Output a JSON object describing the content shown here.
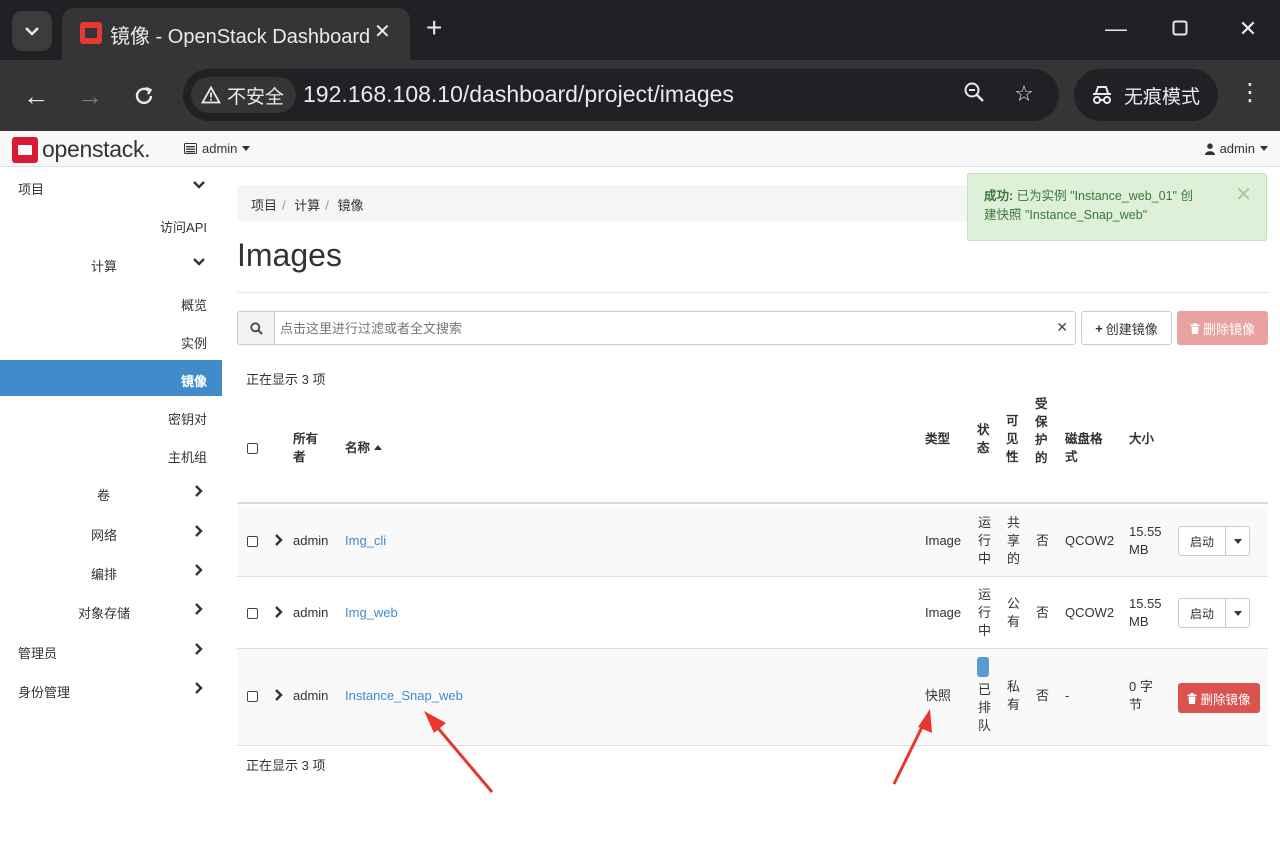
{
  "browser": {
    "tab_title": "镜像 - OpenStack Dashboard",
    "insecure_label": "不安全",
    "url": "192.168.108.10/dashboard/project/images",
    "incognito_label": "无痕模式"
  },
  "navbar": {
    "project": "admin",
    "user": "admin"
  },
  "sidebar": {
    "project": "项目",
    "access_api": "访问API",
    "compute": "计算",
    "overview": "概览",
    "instances": "实例",
    "images": "镜像",
    "keypairs": "密钥对",
    "server_groups": "主机组",
    "volumes": "卷",
    "network": "网络",
    "orchestration": "编排",
    "object_store": "对象存储",
    "admin": "管理员",
    "identity": "身份管理"
  },
  "breadcrumb": [
    "项目",
    "计算",
    "镜像"
  ],
  "page_title": "Images",
  "alert": {
    "strong": "成功:",
    "text_1": " 已为实例 \"Instance_web_01\" 创",
    "text_2": "建快照 \"Instance_Snap_web\""
  },
  "search": {
    "placeholder": "点击这里进行过滤或者全文搜索"
  },
  "actions": {
    "create": "创建镜像",
    "delete": "删除镜像"
  },
  "showing": "正在显示 3 项",
  "table": {
    "headers": {
      "owner_1": "所有",
      "owner_2": "者",
      "name": "名称",
      "type": "类型",
      "status_1": "状",
      "status_2": "态",
      "visibility_1": "可",
      "visibility_2": "见",
      "visibility_3": "性",
      "protected_1": "受",
      "protected_2": "保",
      "protected_3": "护",
      "protected_4": "的",
      "format_1": "磁盘格",
      "format_2": "式",
      "size": "大小"
    },
    "rows": [
      {
        "owner": "admin",
        "name": "Img_cli",
        "type": "Image",
        "status_1": "运",
        "status_2": "行",
        "status_3": "中",
        "visibility_1": "共",
        "visibility_2": "享",
        "visibility_3": "的",
        "protected": "否",
        "format": "QCOW2",
        "size_1": "15.55",
        "size_2": "MB",
        "action": "启动"
      },
      {
        "owner": "admin",
        "name": "Img_web",
        "type": "Image",
        "status_1": "运",
        "status_2": "行",
        "status_3": "中",
        "visibility_1": "公",
        "visibility_2": "有",
        "protected": "否",
        "format": "QCOW2",
        "size_1": "15.55",
        "size_2": "MB",
        "action": "启动"
      },
      {
        "owner": "admin",
        "name": "Instance_Snap_web",
        "type": "快照",
        "status_1": "已",
        "status_2": "排",
        "status_3": "队",
        "visibility_1": "私",
        "visibility_2": "有",
        "protected": "否",
        "format": "-",
        "size_1": "0 字",
        "size_2": "节",
        "action": "删除镜像"
      }
    ]
  },
  "colors": {
    "accent": "#428bca",
    "danger": "#d9534f",
    "success_bg": "#dff0d8",
    "annotation_arrow": "#e8372f"
  }
}
